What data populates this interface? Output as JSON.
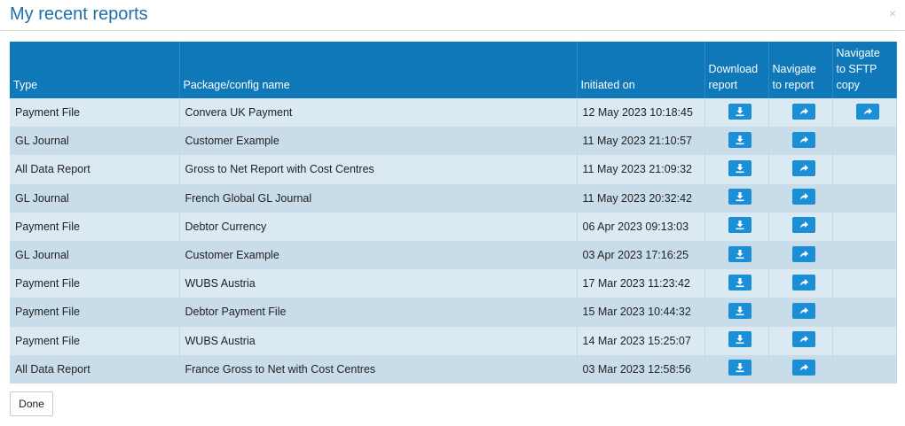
{
  "dialog": {
    "title": "My recent reports",
    "close_glyph": "×",
    "done_label": "Done"
  },
  "table": {
    "headers": {
      "type": "Type",
      "package": "Package/config name",
      "initiated": "Initiated on",
      "download": "Download report",
      "navigate": "Navigate to report",
      "sftp": "Navigate to SFTP copy"
    },
    "rows": [
      {
        "type": "Payment File",
        "package": "Convera UK Payment",
        "initiated": "12 May 2023 10:18:45",
        "has_sftp": true
      },
      {
        "type": "GL Journal",
        "package": "Customer Example",
        "initiated": "11 May 2023 21:10:57",
        "has_sftp": false
      },
      {
        "type": "All Data Report",
        "package": "Gross to Net Report with Cost Centres",
        "initiated": "11 May 2023 21:09:32",
        "has_sftp": false
      },
      {
        "type": "GL Journal",
        "package": "French Global GL Journal",
        "initiated": "11 May 2023 20:32:42",
        "has_sftp": false
      },
      {
        "type": "Payment File",
        "package": "Debtor Currency",
        "initiated": "06 Apr 2023 09:13:03",
        "has_sftp": false
      },
      {
        "type": "GL Journal",
        "package": "Customer Example",
        "initiated": "03 Apr 2023 17:16:25",
        "has_sftp": false
      },
      {
        "type": "Payment File",
        "package": "WUBS Austria",
        "initiated": "17 Mar 2023 11:23:42",
        "has_sftp": false
      },
      {
        "type": "Payment File",
        "package": "Debtor Payment File",
        "initiated": "15 Mar 2023 10:44:32",
        "has_sftp": false
      },
      {
        "type": "Payment File",
        "package": "WUBS Austria",
        "initiated": "14 Mar 2023 15:25:07",
        "has_sftp": false
      },
      {
        "type": "All Data Report",
        "package": "France Gross to Net with Cost Centres",
        "initiated": "03 Mar 2023 12:58:56",
        "has_sftp": false
      }
    ]
  },
  "icons": {
    "download": "download-icon",
    "navigate": "share-arrow-icon",
    "sftp": "share-arrow-icon"
  },
  "colors": {
    "title": "#1f6fa8",
    "header_bg": "#0f78b9",
    "row_light": "#dbe9f3",
    "row_dark": "#c9dce9",
    "button": "#1a8fd6"
  }
}
